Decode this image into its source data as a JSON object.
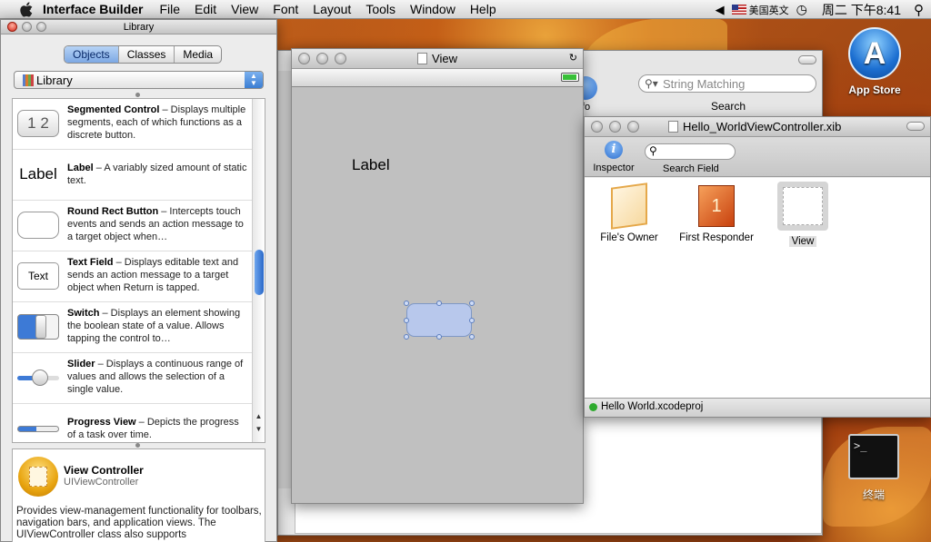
{
  "menubar": {
    "app": "Interface Builder",
    "menus": [
      "File",
      "Edit",
      "View",
      "Font",
      "Layout",
      "Tools",
      "Window",
      "Help"
    ],
    "input_method": "美国英文",
    "clock": "周二 下午8:41"
  },
  "library": {
    "title": "Library",
    "tabs": [
      "Objects",
      "Classes",
      "Media"
    ],
    "active_tab": "Objects",
    "selector": "Library",
    "items": [
      {
        "name": "Segmented Control",
        "desc": " – Displays multiple segments, each of which functions as a discrete button.",
        "icon": "segmented-control-icon",
        "glyph": "1 2"
      },
      {
        "name": "Label",
        "desc": " – A variably sized amount of static text.",
        "icon": "label-icon",
        "glyph": "Label"
      },
      {
        "name": "Round Rect Button",
        "desc": " – Intercepts touch events and sends an action message to a target object when…",
        "icon": "round-rect-button-icon",
        "glyph": ""
      },
      {
        "name": "Text Field",
        "desc": " – Displays editable text and sends an action message to a target object when Return is tapped.",
        "icon": "text-field-icon",
        "glyph": "Text"
      },
      {
        "name": "Switch",
        "desc": " – Displays an element showing the boolean state of a value. Allows tapping the control to…",
        "icon": "switch-icon",
        "glyph": ""
      },
      {
        "name": "Slider",
        "desc": " – Displays a continuous range of values and allows the selection of a single value.",
        "icon": "slider-icon",
        "glyph": ""
      },
      {
        "name": "Progress View",
        "desc": " – Depicts the progress of a task over time.",
        "icon": "progress-view-icon",
        "glyph": ""
      }
    ],
    "detail": {
      "name": "View Controller",
      "class": "UIViewController",
      "desc": "Provides view-management functionality for toolbars, navigation bars, and application views. The UIViewController class also supports"
    }
  },
  "project_window": {
    "search_placeholder": "String Matching",
    "search_label": "Search",
    "info_label": "fo"
  },
  "view_window": {
    "title": "View",
    "label_text": "Label"
  },
  "xib_window": {
    "title": "Hello_WorldViewController.xib",
    "toolbar": {
      "inspector": "Inspector",
      "search_field": "Search Field"
    },
    "objects": [
      "File's Owner",
      "First Responder",
      "View"
    ],
    "status": "Hello World.xcodeproj"
  },
  "desktop": {
    "app_store": "App Store",
    "terminal": "终端"
  }
}
